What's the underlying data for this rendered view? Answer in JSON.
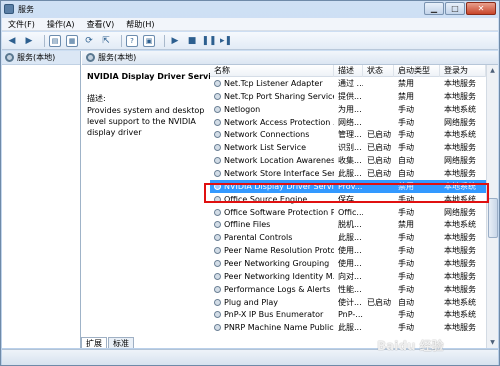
{
  "window": {
    "title": "服务"
  },
  "menu": [
    "文件(F)",
    "操作(A)",
    "查看(V)",
    "帮助(H)"
  ],
  "left_pane": {
    "item": "服务(本地)"
  },
  "header": {
    "title": "服务(本地)"
  },
  "description_pane": {
    "service_title": "NVIDIA Display Driver Service",
    "label": "描述:",
    "text": "Provides system and desktop level support to the NVIDIA display driver"
  },
  "columns": [
    "名称",
    "描述",
    "状态",
    "启动类型",
    "登录为"
  ],
  "services": [
    {
      "name": "Net.Tcp Listener Adapter",
      "desc": "通过 ...",
      "status": "",
      "startup": "禁用",
      "logon": "本地服务"
    },
    {
      "name": "Net.Tcp Port Sharing Service",
      "desc": "提供...",
      "status": "",
      "startup": "禁用",
      "logon": "本地服务"
    },
    {
      "name": "Netlogon",
      "desc": "为用...",
      "status": "",
      "startup": "手动",
      "logon": "本地系统"
    },
    {
      "name": "Network Access Protection ...",
      "desc": "网络...",
      "status": "",
      "startup": "手动",
      "logon": "网络服务"
    },
    {
      "name": "Network Connections",
      "desc": "管理...",
      "status": "已启动",
      "startup": "手动",
      "logon": "本地系统"
    },
    {
      "name": "Network List Service",
      "desc": "识别...",
      "status": "已启动",
      "startup": "手动",
      "logon": "本地服务"
    },
    {
      "name": "Network Location Awareness",
      "desc": "收集...",
      "status": "已启动",
      "startup": "自动",
      "logon": "网络服务"
    },
    {
      "name": "Network Store Interface Ser...",
      "desc": "此服...",
      "status": "已启动",
      "startup": "自动",
      "logon": "本地服务"
    },
    {
      "name": "NVIDIA Display Driver Service",
      "desc": "Prov...",
      "status": "",
      "startup": "禁用",
      "logon": "本地系统",
      "selected": true
    },
    {
      "name": "Office  Source Engine",
      "desc": "保存...",
      "status": "",
      "startup": "手动",
      "logon": "本地系统"
    },
    {
      "name": "Office Software Protection P...",
      "desc": "Offic...",
      "status": "",
      "startup": "手动",
      "logon": "网络服务"
    },
    {
      "name": "Offline Files",
      "desc": "脱机...",
      "status": "",
      "startup": "禁用",
      "logon": "本地系统"
    },
    {
      "name": "Parental Controls",
      "desc": "此服...",
      "status": "",
      "startup": "手动",
      "logon": "本地服务"
    },
    {
      "name": "Peer Name Resolution Proto...",
      "desc": "使用...",
      "status": "",
      "startup": "手动",
      "logon": "本地服务"
    },
    {
      "name": "Peer Networking Grouping",
      "desc": "使用...",
      "status": "",
      "startup": "手动",
      "logon": "本地服务"
    },
    {
      "name": "Peer Networking Identity M...",
      "desc": "向对...",
      "status": "",
      "startup": "手动",
      "logon": "本地服务"
    },
    {
      "name": "Performance Logs & Alerts",
      "desc": "性能...",
      "status": "",
      "startup": "手动",
      "logon": "本地服务"
    },
    {
      "name": "Plug and Play",
      "desc": "使计...",
      "status": "已启动",
      "startup": "自动",
      "logon": "本地系统"
    },
    {
      "name": "PnP-X IP Bus Enumerator",
      "desc": "PnP-...",
      "status": "",
      "startup": "手动",
      "logon": "本地系统"
    },
    {
      "name": "PNRP Machine Name Public...",
      "desc": "此服...",
      "status": "",
      "startup": "手动",
      "logon": "本地服务"
    }
  ],
  "tabs": [
    "扩展",
    "标准"
  ],
  "watermark": "Baidu 经验"
}
